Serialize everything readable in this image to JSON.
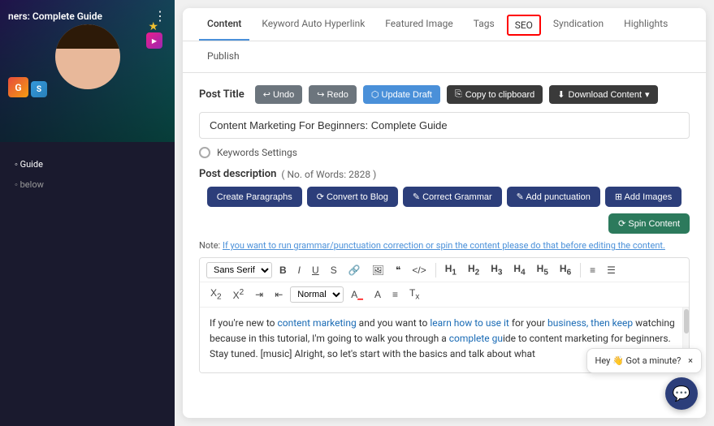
{
  "sidebar": {
    "image_title": "ners: Complete Guide",
    "nav_items": [
      {
        "label": "◦ Guide",
        "active": false
      },
      {
        "label": "◦ below",
        "active": false
      }
    ]
  },
  "tabs": {
    "items": [
      {
        "id": "content",
        "label": "Content",
        "active": true
      },
      {
        "id": "keyword-auto-hyperlink",
        "label": "Keyword Auto Hyperlink",
        "active": false
      },
      {
        "id": "featured-image",
        "label": "Featured Image",
        "active": false
      },
      {
        "id": "tags",
        "label": "Tags",
        "active": false
      },
      {
        "id": "seo",
        "label": "SEO",
        "active": false,
        "highlighted": true
      },
      {
        "id": "syndication",
        "label": "Syndication",
        "active": false
      },
      {
        "id": "highlights",
        "label": "Highlights",
        "active": false
      }
    ],
    "sub_items": [
      {
        "id": "publish",
        "label": "Publish",
        "active": false
      }
    ]
  },
  "toolbar": {
    "undo_label": "↩ Undo",
    "redo_label": "↪ Redo",
    "update_draft_label": "⬡ Update Draft",
    "copy_clipboard_label": "Copy to clipboard",
    "download_content_label": "Download Content"
  },
  "post_title": {
    "label": "Post Title",
    "value": "Content Marketing For Beginners: Complete Guide"
  },
  "keywords_settings": {
    "label": "Keywords Settings"
  },
  "post_description": {
    "label": "Post description",
    "word_count_label": "( No. of Words: 2828 )"
  },
  "action_buttons": {
    "create_paragraphs": "Create Paragraphs",
    "convert_to_blog": "⟳ Convert to Blog",
    "correct_grammar": "✎ Correct Grammar",
    "add_punctuation": "✎ Add punctuation",
    "add_images": "⊞ Add Images",
    "spin_content": "⟳ Spin Content"
  },
  "note": {
    "prefix": "Note: ",
    "link_text": "If you want to run grammar/punctuation correction or spin the content please do that before editing the content."
  },
  "editor": {
    "font_select": "Sans Serif",
    "format_select": "Normal",
    "heading_options": [
      "H1",
      "H2",
      "H3",
      "H4",
      "H5",
      "H6"
    ],
    "content": "If you're new to content marketing and you want to learn how to use it for your business, then keep watching because in this tutorial, I'm going to walk you through a complete guide to content marketing for beginners. Stay tuned. [music] Alright, so let's start with the basics and talk about what"
  },
  "chat": {
    "icon": "💬",
    "tooltip_label": "Hey 👋 Got a minute?",
    "close_label": "×"
  }
}
